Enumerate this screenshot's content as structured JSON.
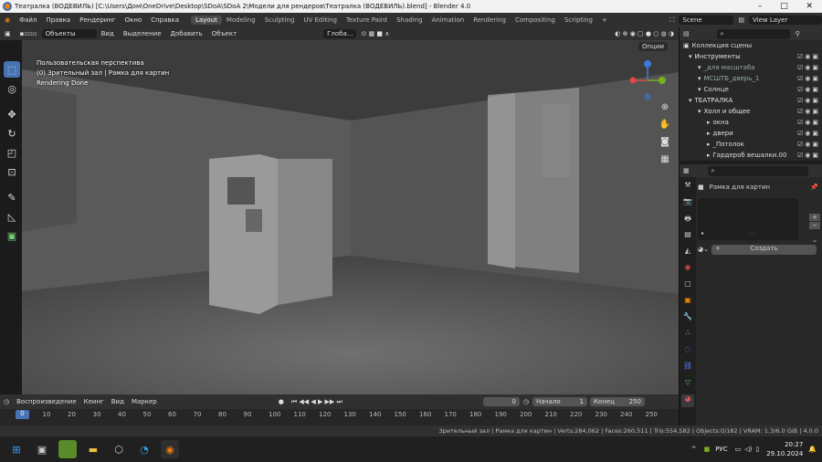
{
  "window": {
    "title": "Театралка (ВОДЕВИЛЬ) [C:\\Users\\Дом\\OneDrive\\Desktop\\SDoA\\SDoA 2\\Модели для рендеров\\Театралка (ВОДЕВИЛЬ).blend] - Blender 4.0"
  },
  "menu": [
    "Файл",
    "Правка",
    "Рендеринг",
    "Окно",
    "Справка"
  ],
  "workspaces": [
    "Layout",
    "Modeling",
    "Sculpting",
    "UV Editing",
    "Texture Paint",
    "Shading",
    "Animation",
    "Rendering",
    "Compositing",
    "Scripting"
  ],
  "add_ws": "+",
  "scene": {
    "label": "Scene",
    "view_layer": "View Layer"
  },
  "vp_header": {
    "mode": "Объекты",
    "items": [
      "Вид",
      "Выделение",
      "Добавить",
      "Объект"
    ],
    "orient": "Глоба...",
    "options": "Опции"
  },
  "overlay": {
    "line1": "Пользовательская перспектива",
    "line2": "(0) Зрительный зал | Рамка для картин",
    "line3": "Rendering Done"
  },
  "timeline": {
    "playback": "Воспроизведение",
    "keying": "Кеинг",
    "view": "Вид",
    "marker": "Маркер",
    "current": "0",
    "start_label": "Начало",
    "start": "1",
    "end_label": "Конец",
    "end": "250"
  },
  "ruler": [
    "0",
    "10",
    "20",
    "30",
    "40",
    "50",
    "60",
    "70",
    "80",
    "90",
    "100",
    "110",
    "120",
    "130",
    "140",
    "150",
    "160",
    "170",
    "180",
    "190",
    "200",
    "210",
    "220",
    "230",
    "240",
    "250"
  ],
  "status": "Зрительный зал | Рамка для картин | Verts:284,062 | Faces:260,511 | Tris:554,582 | Objects:0/182 | VRAM: 1.3/6.0 GiB | 4.0.0",
  "outliner": {
    "title": "Коллекция сцены",
    "rows": [
      {
        "label": "Инструменты",
        "indent": 1,
        "c": "#e6e6e6"
      },
      {
        "label": "_для масштаба",
        "indent": 2,
        "c": "#9aa"
      },
      {
        "label": "МСШТБ_дверь_1",
        "indent": 2,
        "c": "#9aa"
      },
      {
        "label": "Солнце",
        "indent": 2,
        "c": "#ddd"
      },
      {
        "label": "ТЕАТРАЛКА",
        "indent": 1,
        "c": "#e6e6e6"
      },
      {
        "label": "Холл и общее",
        "indent": 2,
        "c": "#e6e6e6"
      },
      {
        "label": "окна",
        "indent": 3,
        "c": "#ddd"
      },
      {
        "label": "двери",
        "indent": 3,
        "c": "#ddd"
      },
      {
        "label": "_Потолок",
        "indent": 3,
        "c": "#ddd"
      },
      {
        "label": "Гардероб вешалки.00",
        "indent": 3,
        "c": "#ddd"
      }
    ]
  },
  "props": {
    "material": "Рамка для картин",
    "create": "Создать"
  },
  "taskbar": {
    "lang": "РУС",
    "time": "20:27",
    "date": "29.10.2024"
  },
  "colors": {
    "accent": "#4772b3",
    "header": "#303030",
    "panel": "#282828"
  }
}
